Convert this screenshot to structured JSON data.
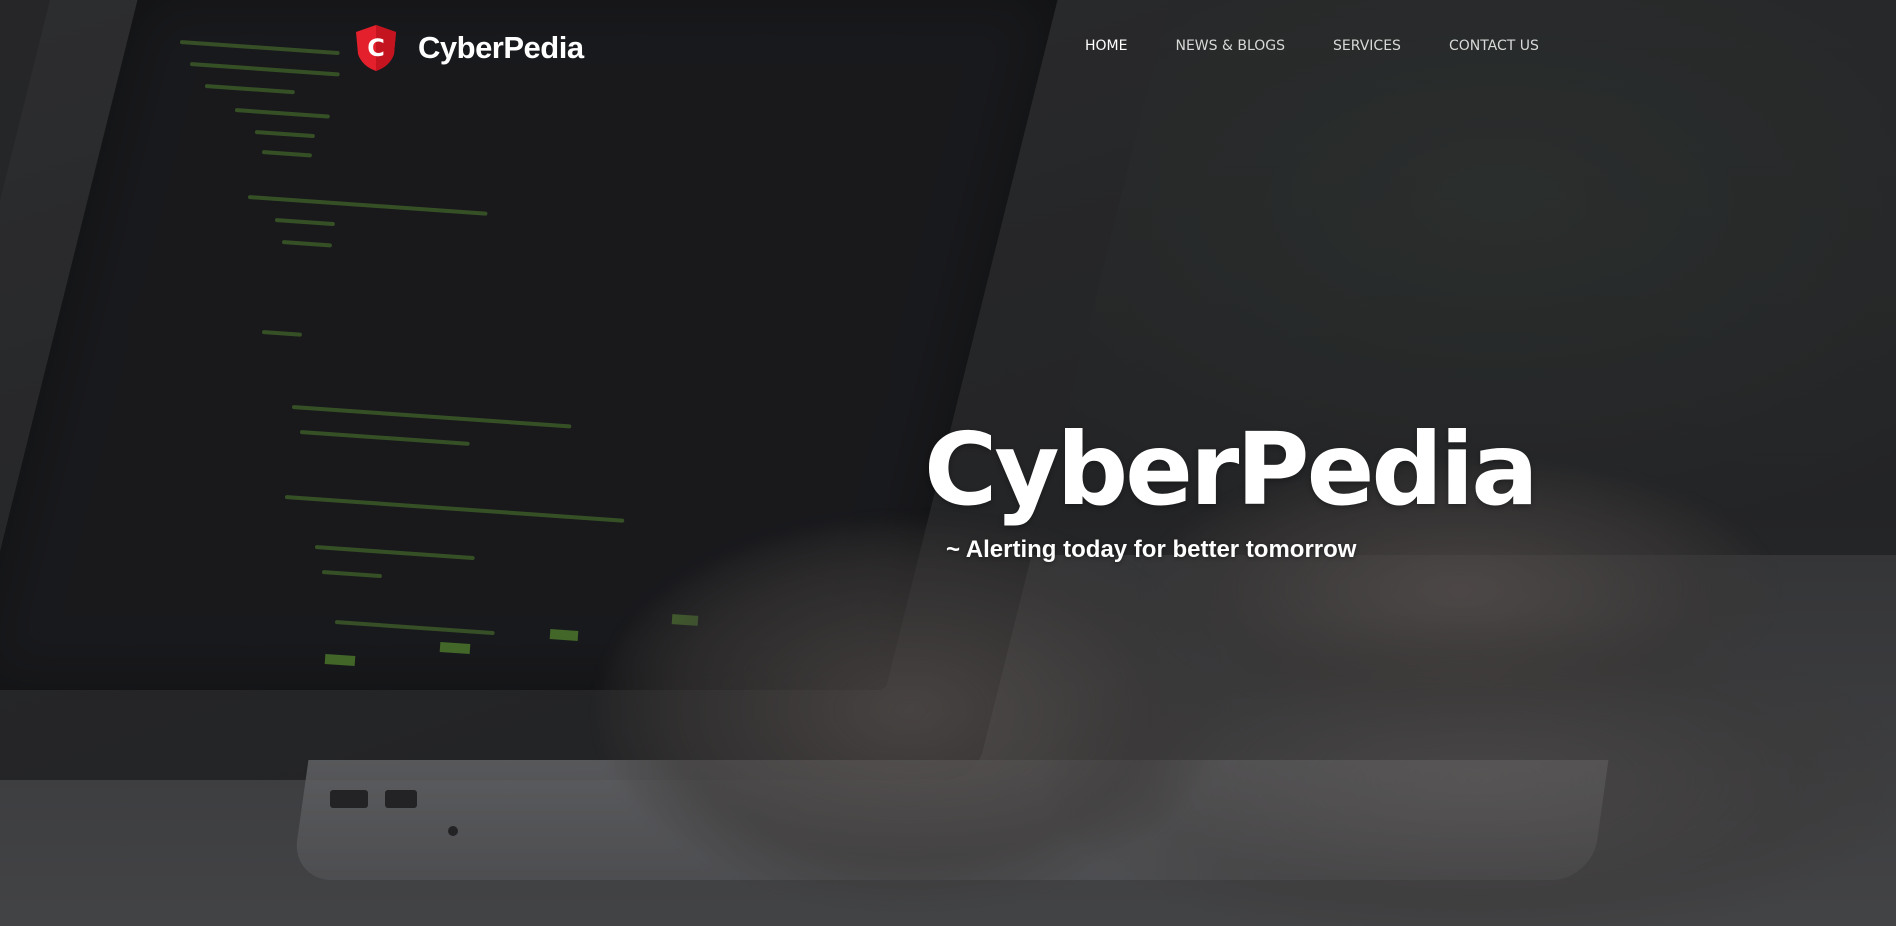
{
  "brand": {
    "name": "CyberPedia",
    "logo_letter": "C",
    "logo_icon": "shield-logo-icon",
    "logo_color": "#e3202b"
  },
  "nav": {
    "items": [
      {
        "label": "HOME",
        "active": true
      },
      {
        "label": "NEWS & BLOGS",
        "active": false
      },
      {
        "label": "SERVICES",
        "active": false
      },
      {
        "label": "CONTACT US",
        "active": false
      }
    ]
  },
  "hero": {
    "title": "CyberPedia",
    "tagline": "~ Alerting today for better tomorrow"
  }
}
